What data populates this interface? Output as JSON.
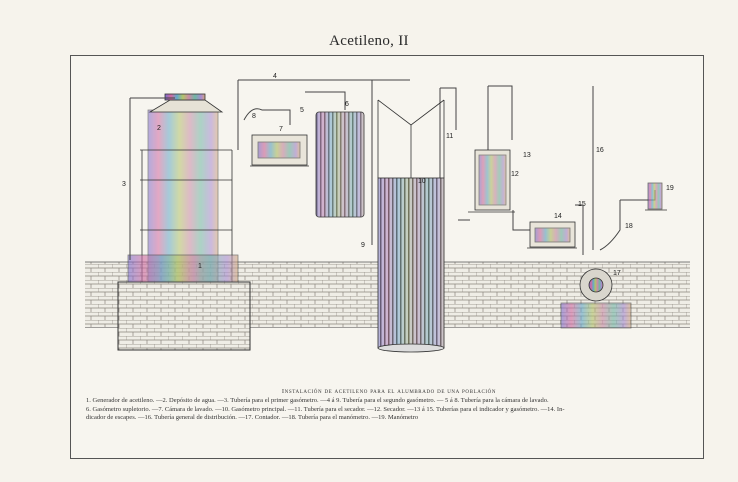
{
  "page": {
    "title": "Acetileno, II"
  },
  "labels": [
    "1",
    "2",
    "3",
    "4",
    "5",
    "6",
    "7",
    "8",
    "9",
    "10",
    "11",
    "12",
    "13",
    "14",
    "15",
    "16",
    "17",
    "18",
    "19"
  ],
  "caption": {
    "heading": "Instalación de acetileno para el alumbrado de una población",
    "lines": [
      "1. Generador de acetileno. —2. Depósito de agua. —3. Tubería para el primer gasómetro. —4 á 9. Tubería para el segundo gasómetro. — 5 á 8. Tubería para la cámara de lavado.",
      "6. Gasómetro supletorio. —7. Cámara de lavado. —10. Gasómetro principal. —11. Tubería para el secador. —12. Secador. —13 á 15. Tuberías para el indicador y gasómetro. —14. In-",
      "dicador de escapes. —16. Tubería general de distribución. —17. Contador. —18. Tubería para el manómetro. —19. Manómetro"
    ]
  },
  "colors": {
    "ink": "#2b2b2b",
    "brick": "#6f6a62",
    "paper": "#f7f5ef"
  }
}
